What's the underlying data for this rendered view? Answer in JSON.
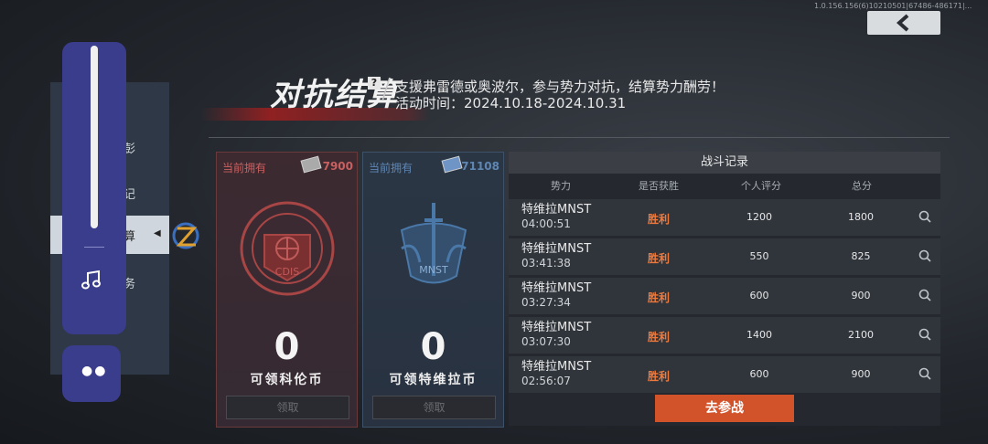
{
  "header": {
    "title": "对抗结算",
    "help": "?",
    "subtitle": "支援弗雷德或奥波尔，参与势力对抗，结算势力酬劳！",
    "date": "活动时间：2024.10.18-2024.10.31",
    "version": "1.0.156.156(6)10210501|67486-486171|..."
  },
  "side_menu": {
    "items": [
      {
        "label": "彭"
      },
      {
        "label": "记"
      },
      {
        "label": "算"
      },
      {
        "label": "务"
      }
    ]
  },
  "volume": {
    "level": 1.0
  },
  "cards": [
    {
      "owned_label": "当前拥有",
      "count": "7900",
      "amount": "0",
      "label": "可领科伦币",
      "claim": "领取",
      "emblem_text": "CDIS",
      "accent": "#c04a4a"
    },
    {
      "owned_label": "当前拥有",
      "count": "71108",
      "amount": "0",
      "label": "可领特维拉币",
      "claim": "领取",
      "emblem_text": "MNST",
      "accent": "#4a78a8"
    }
  ],
  "records": {
    "title": "战斗记录",
    "columns": [
      "势力",
      "是否获胜",
      "个人评分",
      "总分"
    ],
    "rows": [
      {
        "faction": "特维拉MNST",
        "time": "04:00:51",
        "result": "胜利",
        "score": "1200",
        "total": "1800"
      },
      {
        "faction": "特维拉MNST",
        "time": "03:41:38",
        "result": "胜利",
        "score": "550",
        "total": "825"
      },
      {
        "faction": "特维拉MNST",
        "time": "03:27:34",
        "result": "胜利",
        "score": "600",
        "total": "900"
      },
      {
        "faction": "特维拉MNST",
        "time": "03:07:30",
        "result": "胜利",
        "score": "1400",
        "total": "2100"
      },
      {
        "faction": "特维拉MNST",
        "time": "02:56:07",
        "result": "胜利",
        "score": "600",
        "total": "900"
      }
    ],
    "join_button": "去参战"
  },
  "colors": {
    "win": "#f07a3c",
    "join": "#d2522a",
    "slider": "#3a3c8c"
  }
}
